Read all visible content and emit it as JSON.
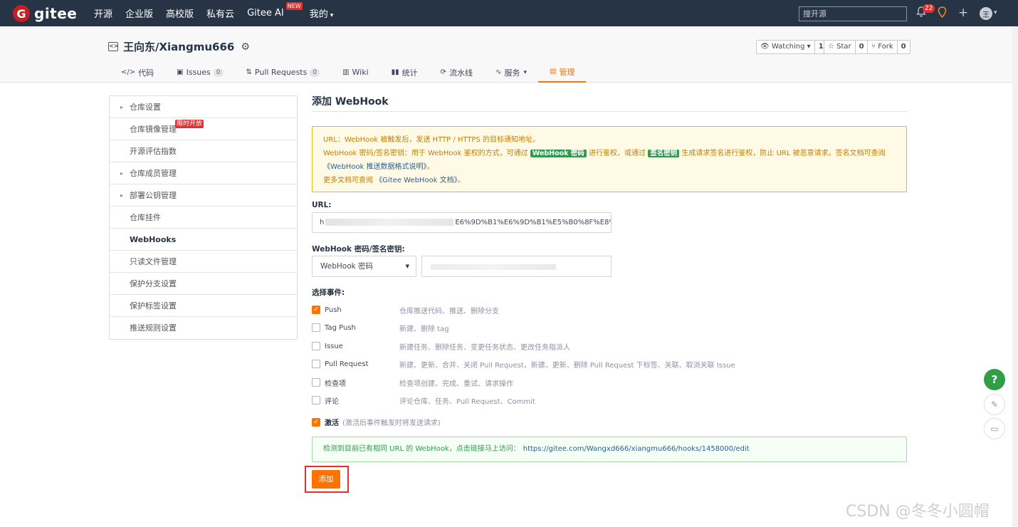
{
  "nav": {
    "logo_letter": "G",
    "logo_text": "gitee",
    "links": [
      "开源",
      "企业版",
      "高校版",
      "私有云",
      "Gitee AI",
      "我的"
    ],
    "new_badge": "NEW",
    "search_placeholder": "搜开源",
    "notification_count": "22",
    "avatar_letter": "王"
  },
  "project": {
    "title": "王向东/Xiangmu666",
    "watch_label": "Watching",
    "watch_count": "1",
    "star_label": "Star",
    "star_count": "0",
    "fork_label": "Fork",
    "fork_count": "0",
    "tabs": [
      {
        "label": "代码",
        "icon": "code-icon"
      },
      {
        "label": "Issues",
        "count": "0",
        "icon": "issues-icon"
      },
      {
        "label": "Pull Requests",
        "count": "0",
        "icon": "pull-request-icon"
      },
      {
        "label": "Wiki",
        "icon": "wiki-icon"
      },
      {
        "label": "统计",
        "icon": "stats-icon"
      },
      {
        "label": "流水线",
        "icon": "pipeline-icon"
      },
      {
        "label": "服务",
        "icon": "service-icon"
      },
      {
        "label": "管理",
        "icon": "manage-icon",
        "active": true
      }
    ]
  },
  "sidebar": {
    "items": [
      {
        "label": "仓库设置",
        "expandable": true
      },
      {
        "label": "仓库镜像管理",
        "tag": "限时开放"
      },
      {
        "label": "开源评估指数"
      },
      {
        "label": "仓库成员管理",
        "expandable": true
      },
      {
        "label": "部署公钥管理",
        "expandable": true
      },
      {
        "label": "仓库挂件"
      },
      {
        "label": "WebHooks",
        "active": true
      },
      {
        "label": "只读文件管理"
      },
      {
        "label": "保护分支设置"
      },
      {
        "label": "保护标签设置"
      },
      {
        "label": "推送规则设置"
      }
    ]
  },
  "form": {
    "title": "添加 WebHook",
    "tips": {
      "line1": "URL：WebHook 被触发后，发送 HTTP / HTTPS 的目标通知地址。",
      "line2_a": "WebHook 密码/签名密钥：用于 WebHook 鉴权的方式，可通过",
      "line2_badge1": "WebHook 密码",
      "line2_b": "进行鉴权，或通过",
      "line2_badge2": "签名密钥",
      "line2_c": "生成请求签名进行鉴权，防止 URL 被恶意请求。签名文档可查阅",
      "line2_link": "《WebHook 推送数据格式说明》",
      "line2_end": "。",
      "line3_a": "更多文档可查阅",
      "line3_link": "《Gitee WebHook 文档》",
      "line3_end": "。"
    },
    "url_label": "URL:",
    "url_prefix": "h",
    "url_value": "E6%9D%B1%E6%9D%B1%E5%B0%8F%E8%",
    "secret_label": "WebHook 密码/签名密钥:",
    "secret_type": "WebHook 密码",
    "events_label": "选择事件:",
    "events": [
      {
        "name": "Push",
        "desc": "仓库推送代码、推送、删除分支",
        "checked": true
      },
      {
        "name": "Tag Push",
        "desc": "新建、删除 tag",
        "checked": false
      },
      {
        "name": "Issue",
        "desc": "新建任务、删除任务、变更任务状态、更改任务指派人",
        "checked": false
      },
      {
        "name": "Pull Request",
        "desc": "新建、更新、合并、关闭 Pull Request，新建、更新、删除 Pull Request 下标签、关联、取消关联 Issue",
        "checked": false
      },
      {
        "name": "检查项",
        "desc": "检查项创建、完成、重试、请求操作",
        "checked": false
      },
      {
        "name": "评论",
        "desc": "评论仓库、任务、Pull Request、Commit",
        "checked": false
      }
    ],
    "activate_label": "激活",
    "activate_hint": "(激活后事件触发时将发送请求)",
    "activate_checked": true,
    "duplicate_notice": "检测到目前已有相同 URL 的 WebHook，点击链接马上访问：",
    "duplicate_link": "https://gitee.com/Wangxd666/xiangmu666/hooks/1458000/edit",
    "submit_label": "添加"
  },
  "floaters": {
    "help": "?",
    "edit_icon": "edit-icon",
    "chat_icon": "chat-icon"
  },
  "watermark": "CSDN @冬冬小圆帽",
  "colors": {
    "nav_bg": "#263445",
    "accent": "#fe7300",
    "brand": "#c71d23",
    "green": "#2f9e44"
  }
}
